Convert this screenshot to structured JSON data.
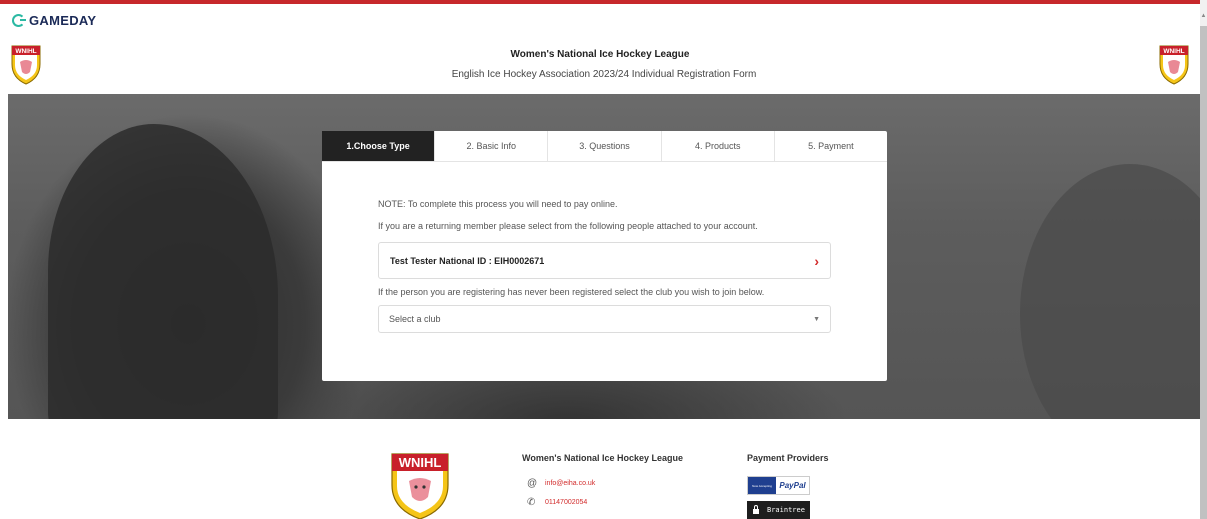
{
  "brand": {
    "name": "GAMEDAY",
    "accent": "#c7282b",
    "logo_teal": "#2bb9a3"
  },
  "header": {
    "league_title": "Women's National Ice Hockey League",
    "form_title": "English Ice Hockey Association 2023/24 Individual Registration Form",
    "crest_text": "WNIHL",
    "crest_subtext": "WOMEN'S NATIONAL ICE HOCKEY LEAGUE"
  },
  "steps": [
    {
      "label": "1.Choose Type",
      "active": true
    },
    {
      "label": "2. Basic Info",
      "active": false
    },
    {
      "label": "3. Questions",
      "active": false
    },
    {
      "label": "4. Products",
      "active": false
    },
    {
      "label": "5. Payment",
      "active": false
    }
  ],
  "form": {
    "note": "NOTE: To complete this process you will need to pay online.",
    "returning_note": "If you are a returning member please select from the following people attached to your account.",
    "person_label": "Test Tester National ID : EIH0002671",
    "never_registered_note": "If the person you are registering has never been registered select the club you wish to join below.",
    "club_select": {
      "selected": "Select a club"
    }
  },
  "footer": {
    "league_name": "Women's National Ice Hockey League",
    "email": "info@eiha.co.uk",
    "phone": "01147002054",
    "providers_title": "Payment Providers",
    "paypal_badge_left": "Now Accepting",
    "paypal_badge_right": "PayPal",
    "braintree_label": "Braintree"
  },
  "icons": {
    "email": "at-icon",
    "phone": "phone-icon",
    "chevron": "chevron-right-icon",
    "caret": "caret-down-icon"
  },
  "colors": {
    "active_tab": "#222222",
    "link_red": "#d22b2b",
    "crest_yellow": "#f5c518",
    "crest_red": "#c8202a"
  }
}
